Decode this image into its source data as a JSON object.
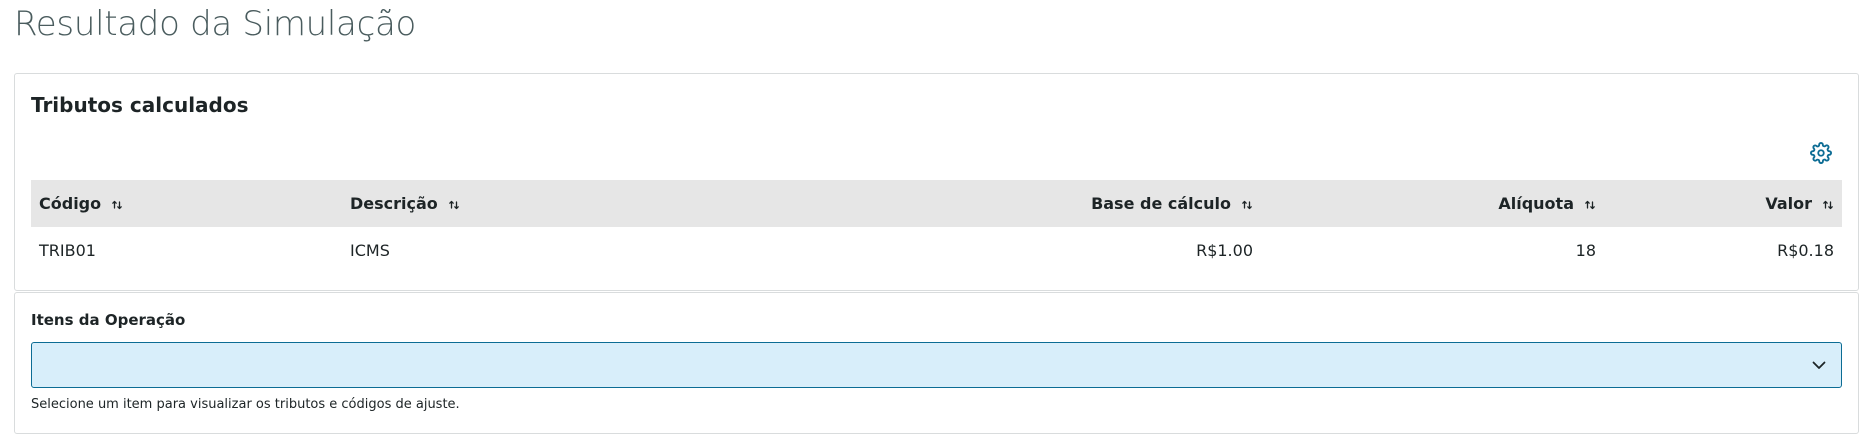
{
  "page": {
    "title": "Resultado da Simulação"
  },
  "tributos": {
    "heading": "Tributos calculados",
    "settings_icon": "gear-icon",
    "columns": [
      {
        "label": "Código",
        "align": "left"
      },
      {
        "label": "Descrição",
        "align": "left"
      },
      {
        "label": "Base de cálculo",
        "align": "right"
      },
      {
        "label": "Alíquota",
        "align": "right"
      },
      {
        "label": "Valor",
        "align": "right"
      }
    ],
    "sort_icon": "sort-arrows-icon",
    "rows": [
      {
        "codigo": "TRIB01",
        "descricao": "ICMS",
        "base": "R$1.00",
        "aliquota": "18",
        "valor": "R$0.18"
      }
    ]
  },
  "itens": {
    "label": "Itens da Operação",
    "selected_value": "",
    "dropdown_icon": "chevron-down-icon",
    "help_text": "Selecione um item para visualizar os tributos e códigos de ajuste."
  },
  "colors": {
    "accent": "#0c6c94",
    "select_background": "#d8eefa",
    "header_background": "#e6e6e6",
    "title_color": "#4a5c5e"
  }
}
